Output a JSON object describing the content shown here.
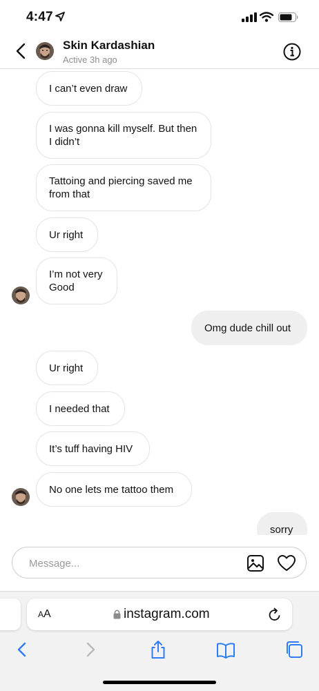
{
  "status_bar": {
    "time": "4:47"
  },
  "header": {
    "name": "Skin Kardashian",
    "active": "Active 3h ago",
    "avatar_icon": "profile-avatar",
    "back_icon": "chevron-left-icon",
    "info_icon": "info-circle-icon"
  },
  "messages": [
    {
      "text": "I can’t even draw",
      "direction": "incoming"
    },
    {
      "text": "I was gonna kill myself. But then I didn’t",
      "direction": "incoming"
    },
    {
      "text": "Tattoing and piercing saved me from that",
      "direction": "incoming"
    },
    {
      "text": "Ur right",
      "direction": "incoming"
    },
    {
      "text": "I’m not very Good",
      "direction": "incoming"
    },
    {
      "text": "Omg dude chill out",
      "direction": "outgoing"
    },
    {
      "text": "Ur right",
      "direction": "incoming"
    },
    {
      "text": "I needed that",
      "direction": "incoming"
    },
    {
      "text": "It’s tuff having HIV",
      "direction": "incoming"
    },
    {
      "text": "No one lets me tattoo them",
      "direction": "incoming"
    },
    {
      "text": "sorry",
      "direction": "outgoing"
    }
  ],
  "composer": {
    "placeholder": "Message...",
    "gallery_icon": "image-icon",
    "like_icon": "heart-icon"
  },
  "safari": {
    "aa_label_small": "A",
    "aa_label_large": "A",
    "url": "instagram.com",
    "toolbar_icons": [
      "back-icon",
      "forward-icon",
      "share-icon",
      "bookmarks-icon",
      "tabs-icon"
    ]
  },
  "colors": {
    "incoming_bubble_border": "#e3e3e3",
    "outgoing_bubble_bg": "#efefef",
    "safari_blue": "#2f7cf6",
    "muted_text": "#8e8e8e"
  }
}
